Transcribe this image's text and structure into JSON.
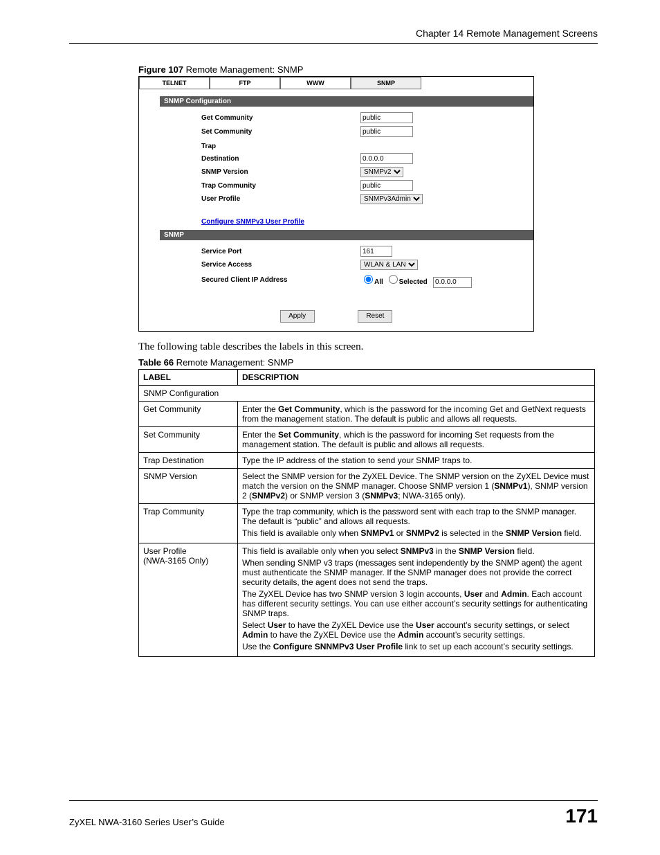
{
  "header": "Chapter 14 Remote Management Screens",
  "figure_caption_bold": "Figure 107",
  "figure_caption_rest": "   Remote Management: SNMP",
  "tabs": {
    "t1": "TELNET",
    "t2": "FTP",
    "t3": "WWW",
    "t4": "SNMP"
  },
  "sec1": "SNMP Configuration",
  "sec2": "SNMP",
  "form": {
    "get_community_lbl": "Get Community",
    "get_community_val": "public",
    "set_community_lbl": "Set Community",
    "set_community_val": "public",
    "trap_lbl": "Trap",
    "destination_lbl": "Destination",
    "destination_val": "0.0.0.0",
    "snmp_version_lbl": "SNMP Version",
    "snmp_version_val": "SNMPv2",
    "trap_community_lbl": "Trap Community",
    "trap_community_val": "public",
    "user_profile_lbl": "User Profile",
    "user_profile_val": "SNMPv3Admin",
    "link": "Configure SNMPv3 User Profile",
    "service_port_lbl": "Service Port",
    "service_port_val": "161",
    "service_access_lbl": "Service Access",
    "service_access_val": "WLAN & LAN",
    "secured_ip_lbl": "Secured Client IP Address",
    "all_lbl": "All",
    "selected_lbl": "Selected",
    "secured_ip_val": "0.0.0.0",
    "apply_btn": "Apply",
    "reset_btn": "Reset"
  },
  "body_text": "The following table describes the labels in this screen.",
  "table_caption_bold": "Table 66",
  "table_caption_rest": "   Remote Management: SNMP",
  "th_label": "LABEL",
  "th_desc": "DESCRIPTION",
  "rows": {
    "r0_l": "SNMP Configuration",
    "r1_l": "Get Community",
    "r1_d_a": "Enter the ",
    "r1_d_b": "Get Community",
    "r1_d_c": ", which is the password for the incoming Get and GetNext requests from the management station. The default is public and allows all requests.",
    "r2_l": "Set Community",
    "r2_d_a": "Enter the ",
    "r2_d_b": "Set Community",
    "r2_d_c": ", which is the password for incoming Set requests from the management station. The default is public and allows all requests.",
    "r3_l": "Trap Destination",
    "r3_d": "Type the IP address of the station to send your SNMP traps to.",
    "r4_l": "SNMP Version",
    "r4_d_a": "Select the SNMP version for the ZyXEL Device. The SNMP version on the ZyXEL Device must match the version on the SNMP manager. Choose SNMP version 1 (",
    "r4_d_b": "SNMPv1",
    "r4_d_c": "), SNMP version 2 (",
    "r4_d_d": "SNMPv2",
    "r4_d_e": ") or SNMP version 3 (",
    "r4_d_f": "SNMPv3",
    "r4_d_g": "; NWA-3165 only).",
    "r5_l": "Trap Community",
    "r5_d1": "Type the trap community, which is the password sent with each trap to the SNMP manager. The default is “public” and allows all requests.",
    "r5_d2a": "This field is available only when ",
    "r5_d2b": "SNMPv1",
    "r5_d2c": " or ",
    "r5_d2d": "SNMPv2",
    "r5_d2e": " is selected in the ",
    "r5_d2f": "SNMP Version",
    "r5_d2g": " field.",
    "r6_l1": "User Profile",
    "r6_l2": "(NWA-3165 Only)",
    "r6_p1a": "This field is available only when you select ",
    "r6_p1b": "SNMPv3",
    "r6_p1c": " in the ",
    "r6_p1d": "SNMP Version",
    "r6_p1e": " field.",
    "r6_p2": "When sending SNMP v3 traps (messages sent independently by the SNMP agent) the agent must authenticate the SNMP manager. If the SNMP manager does not provide the correct security details, the agent does not send the traps.",
    "r6_p3a": "The ZyXEL Device has two SNMP version 3 login accounts, ",
    "r6_p3b": "User",
    "r6_p3c": " and ",
    "r6_p3d": "Admin",
    "r6_p3e": ". Each account has different security settings. You can use either account’s security settings for authenticating SNMP traps.",
    "r6_p4a": "Select ",
    "r6_p4b": "User",
    "r6_p4c": " to have the ZyXEL Device use the ",
    "r6_p4d": "User",
    "r6_p4e": " account’s security settings, or select ",
    "r6_p4f": "Admin",
    "r6_p4g": " to have the ZyXEL Device use the ",
    "r6_p4h": "Admin",
    "r6_p4i": " account’s security settings.",
    "r6_p5a": "Use the ",
    "r6_p5b": "Configure SNNMPv3 User Profile",
    "r6_p5c": " link to set up each account’s security settings."
  },
  "footer_guide": "ZyXEL NWA-3160 Series User’s Guide",
  "footer_page": "171"
}
